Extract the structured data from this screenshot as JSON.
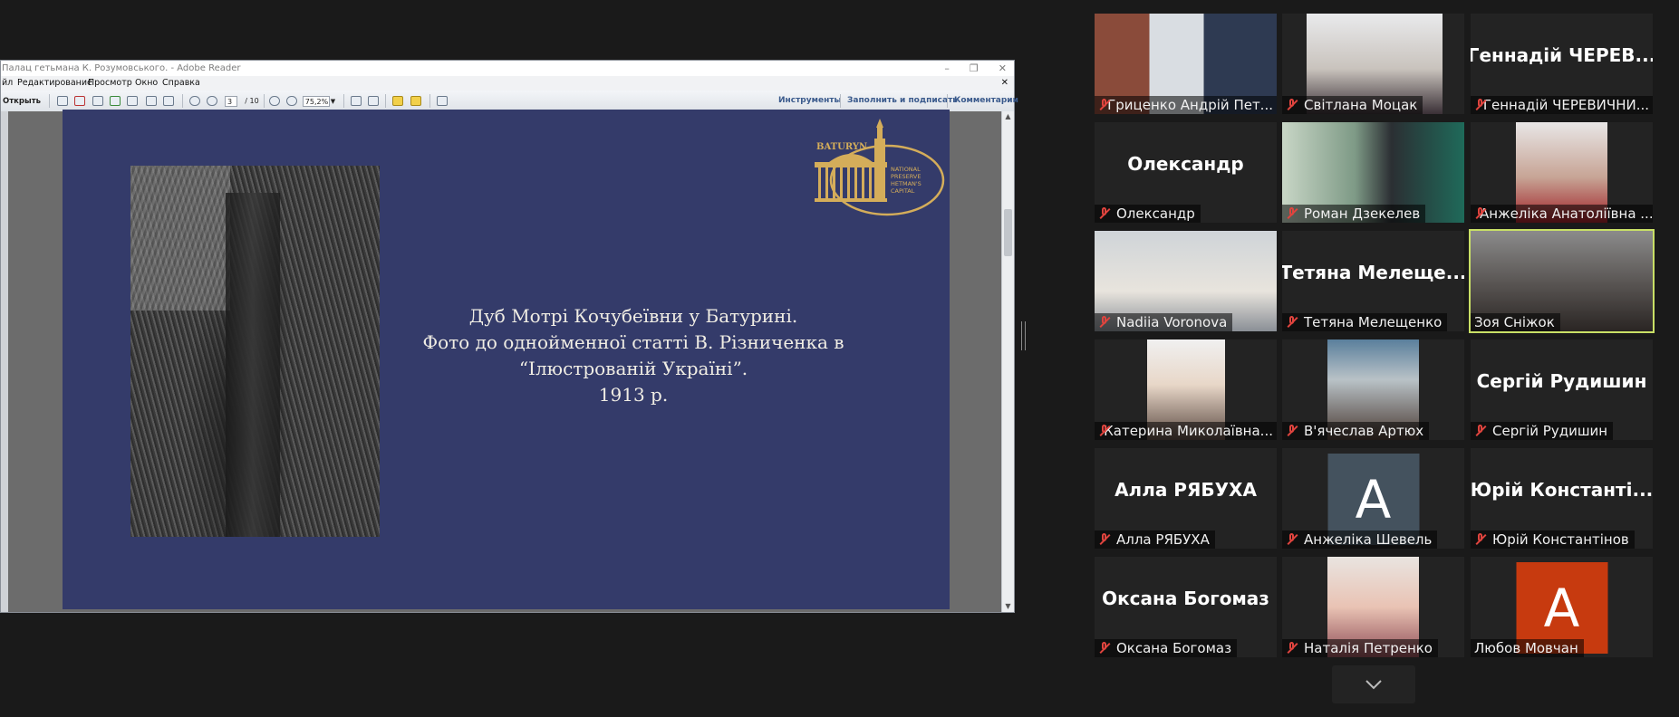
{
  "reader": {
    "title": "Палац гетьмана К. Розумовського. - Adobe Reader",
    "menu": [
      "йл",
      "Редактирование",
      "Просмотр",
      "Окно",
      "Справка"
    ],
    "open_label": "Открыть",
    "page_current": "3",
    "page_total": "/ 10",
    "zoom": "75,2%",
    "tools_label": "Инструменты",
    "fill_sign_label": "Заполнить и подписать",
    "comments_label": "Комментарии"
  },
  "slide": {
    "caption_lines": [
      "Дуб Мотрі Кочубеївни у Батурині.",
      "Фото до однойменної статті В. Різниченка в",
      "“Ілюстрованій Україні”.",
      "1913 р."
    ],
    "logo": {
      "top_text": "BATURYN",
      "right_lines": [
        "NATIONAL",
        "PRESERVE",
        "HETMAN'S",
        "CAPITAL"
      ],
      "color": "#d4ad5a"
    }
  },
  "participants": [
    {
      "name": "Гриценко Андрій Пет...",
      "muted": true,
      "kind": "video",
      "active": false
    },
    {
      "name": "Світлана  Моцак",
      "muted": true,
      "kind": "video",
      "active": false
    },
    {
      "name": "Геннадій ЧЕРЕВИЧНИ...",
      "muted": true,
      "kind": "text",
      "big": "Геннадій  ЧЕРЕВ...",
      "active": false
    },
    {
      "name": "Олександр",
      "muted": true,
      "kind": "text",
      "big": "Олександр",
      "active": false
    },
    {
      "name": "Роман Дзекелев",
      "muted": true,
      "kind": "video",
      "active": false
    },
    {
      "name": "Анжеліка Анатоліївна ...",
      "muted": true,
      "kind": "video",
      "active": false
    },
    {
      "name": "Nadiia Voronova",
      "muted": true,
      "kind": "video",
      "active": false
    },
    {
      "name": "Тетяна Мелещенко",
      "muted": true,
      "kind": "text",
      "big": "Тетяна  Мелеще...",
      "active": false
    },
    {
      "name": "Зоя Сніжок",
      "muted": false,
      "kind": "video",
      "active": true
    },
    {
      "name": "Катерина Миколаївна...",
      "muted": true,
      "kind": "video",
      "active": false
    },
    {
      "name": "В'ячеслав Артюх",
      "muted": true,
      "kind": "video",
      "active": false
    },
    {
      "name": "Сергій Рудишин",
      "muted": true,
      "kind": "text",
      "big": "Сергій  Рудишин",
      "active": false
    },
    {
      "name": "Алла  РЯБУХА",
      "muted": true,
      "kind": "text",
      "big": "Алла  РЯБУХА",
      "active": false
    },
    {
      "name": "Анжеліка Шевель",
      "muted": true,
      "kind": "avatar",
      "letter": "А",
      "avatar_color": "#44525e",
      "active": false
    },
    {
      "name": "Юрій Константінов",
      "muted": true,
      "kind": "text",
      "big": "Юрій  Константі...",
      "active": false
    },
    {
      "name": "Оксана Богомаз",
      "muted": true,
      "kind": "text",
      "big": "Оксана  Богомаз",
      "active": false
    },
    {
      "name": "Наталія Петренко",
      "muted": true,
      "kind": "video",
      "active": false
    },
    {
      "name": "Любов Мовчан",
      "muted": false,
      "kind": "avatar",
      "letter": "А",
      "avatar_color": "#c73a0f",
      "active": false
    }
  ],
  "colors": {
    "slide_bg": "#343b6a",
    "active_speaker": "#c9e066",
    "muted_icon": "#e0443e"
  }
}
